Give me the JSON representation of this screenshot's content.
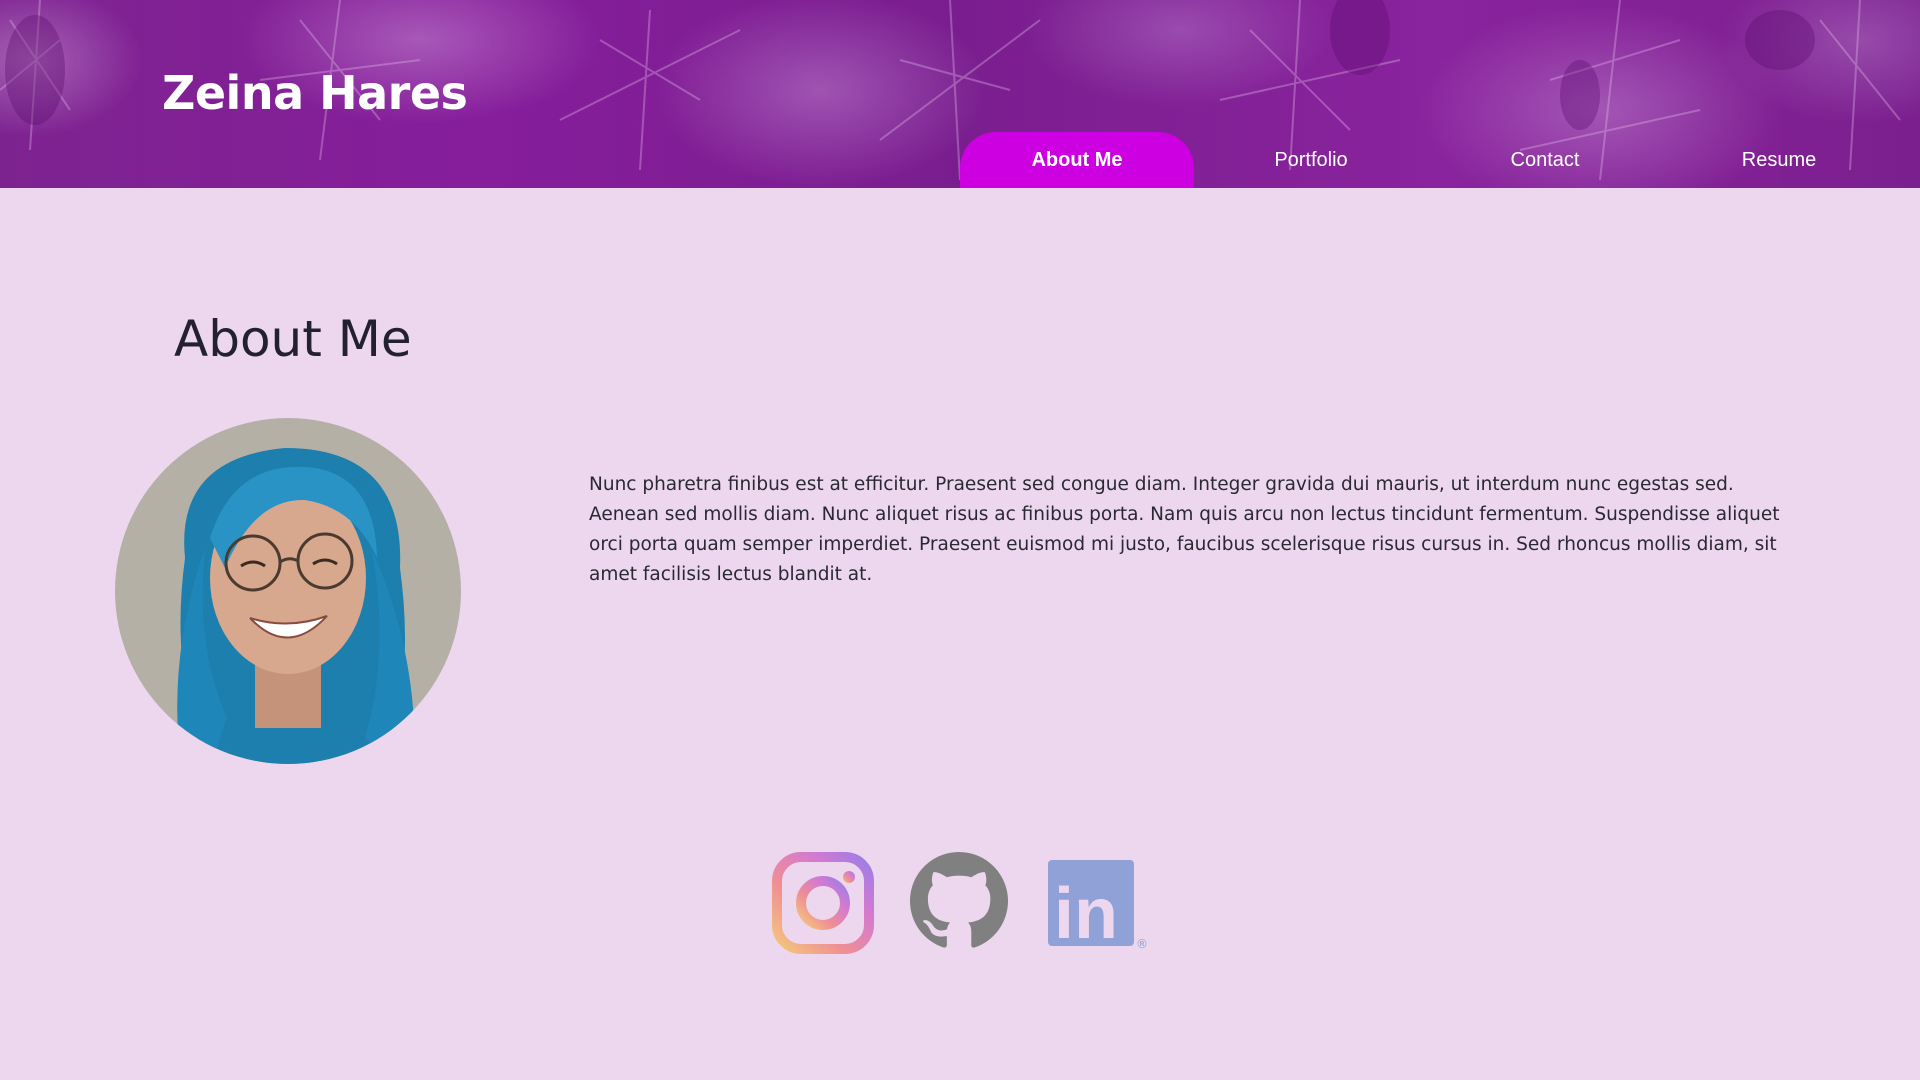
{
  "site": {
    "title": "Zeina Hares"
  },
  "nav": {
    "items": [
      {
        "label": "About Me",
        "active": true
      },
      {
        "label": "Portfolio",
        "active": false
      },
      {
        "label": "Contact",
        "active": false
      },
      {
        "label": "Resume",
        "active": false
      }
    ]
  },
  "main": {
    "heading": "About Me",
    "avatar_icon": "profile-photo",
    "bio": "Nunc pharetra finibus est at efficitur. Praesent sed congue diam. Integer gravida dui mauris, ut interdum nunc egestas sed. Aenean sed mollis diam. Nunc aliquet risus ac finibus porta. Nam quis arcu non lectus tincidunt fermentum. Suspendisse aliquet orci porta quam semper imperdiet. Praesent euismod mi justo, faucibus scelerisque risus cursus in. Sed rhoncus mollis diam, sit amet facilisis lectus blandit at."
  },
  "social": {
    "icons": [
      "instagram-icon",
      "github-icon",
      "linkedin-icon"
    ],
    "linkedin_mark": "in",
    "linkedin_registered": "®"
  },
  "colors": {
    "background": "#ecd7ef",
    "header": "#7d2390",
    "nav_active": "#cc00e0",
    "heading_text": "#232031",
    "github_gray": "#808080",
    "linkedin_blue": "#8fa1d6"
  }
}
